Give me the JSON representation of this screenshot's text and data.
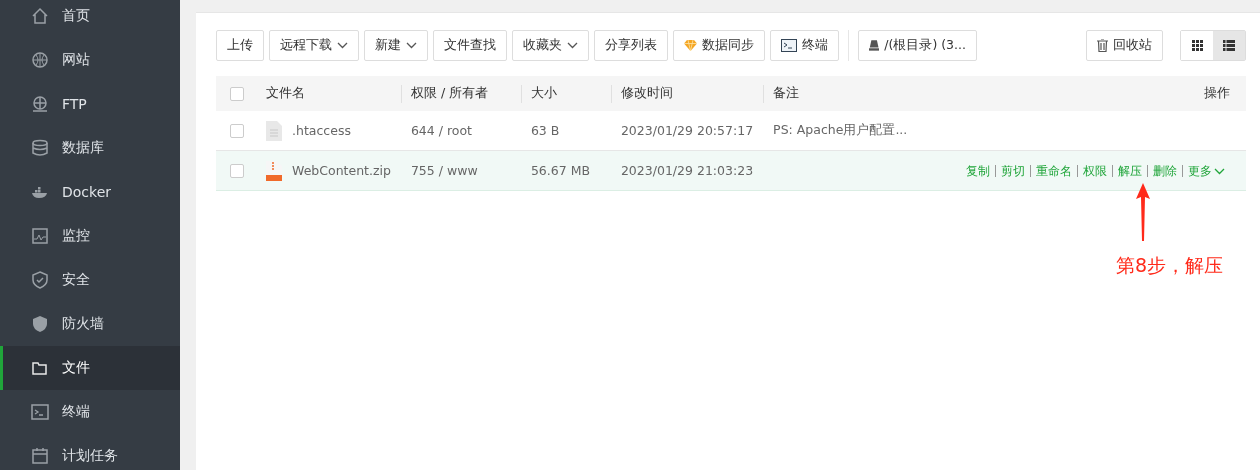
{
  "sidebar": {
    "items": [
      {
        "label": "首页",
        "kind": "home",
        "selected": false
      },
      {
        "label": "网站",
        "kind": "globe",
        "selected": false
      },
      {
        "label": "FTP",
        "kind": "ftp",
        "selected": false
      },
      {
        "label": "数据库",
        "kind": "database",
        "selected": false
      },
      {
        "label": "Docker",
        "kind": "docker",
        "selected": false
      },
      {
        "label": "监控",
        "kind": "monitor",
        "selected": false
      },
      {
        "label": "安全",
        "kind": "shield",
        "selected": false
      },
      {
        "label": "防火墙",
        "kind": "firewall",
        "selected": false
      },
      {
        "label": "文件",
        "kind": "folder",
        "selected": true
      },
      {
        "label": "终端",
        "kind": "terminal",
        "selected": false
      },
      {
        "label": "计划任务",
        "kind": "calendar",
        "selected": false
      }
    ]
  },
  "toolbar": {
    "buttons": [
      {
        "label": "上传",
        "kind": "plain"
      },
      {
        "label": "远程下载",
        "kind": "dropdown"
      },
      {
        "label": "新建",
        "kind": "dropdown"
      },
      {
        "label": "文件查找",
        "kind": "plain"
      },
      {
        "label": "收藏夹",
        "kind": "dropdown"
      },
      {
        "label": "分享列表",
        "kind": "plain"
      },
      {
        "label": "数据同步",
        "kind": "gem"
      },
      {
        "label": "终端",
        "kind": "terminal"
      }
    ],
    "path": "/(根目录) (3...",
    "recycle": "回收站",
    "views": [
      {
        "kind": "grid",
        "selected": false
      },
      {
        "kind": "list",
        "selected": true
      }
    ]
  },
  "table": {
    "header_checked": false,
    "columns": [
      "文件名",
      "权限 / 所有者",
      "大小",
      "修改时间",
      "备注",
      "操作"
    ],
    "rows": [
      {
        "checked": false,
        "kind": "text",
        "highlighted": false,
        "name": ".htaccess",
        "permission": "644 / root",
        "size": "63 B",
        "modified": "2023/01/29 20:57:17",
        "note": "PS: Apache用户配置...",
        "actions": []
      },
      {
        "checked": false,
        "kind": "zip",
        "highlighted": true,
        "name": "WebContent.zip",
        "permission": "755 / www",
        "size": "56.67 MB",
        "modified": "2023/01/29 21:03:23",
        "note": "",
        "actions": [
          "复制",
          "剪切",
          "重命名",
          "权限",
          "解压",
          "删除"
        ],
        "more": "更多"
      }
    ]
  },
  "annotation": {
    "text": "第8步，解压"
  }
}
